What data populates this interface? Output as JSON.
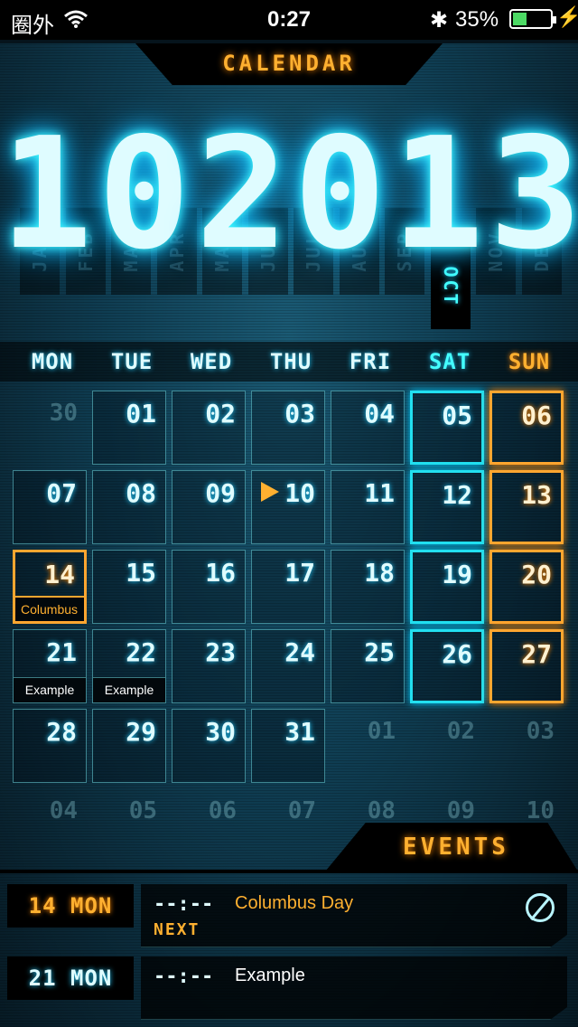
{
  "status_bar": {
    "carrier": "圈外",
    "time": "0:27",
    "battery_percent": "35%",
    "battery_level": 0.35,
    "bluetooth_icon": "bluetooth-icon",
    "wifi_icon": "wifi-icon",
    "charging_icon": "charging-bolt-icon",
    "bluetooth_glyph": "✱",
    "charging_glyph": "⚡"
  },
  "header": {
    "title": "CALENDAR"
  },
  "big_date": {
    "month": "10",
    "year": "2013"
  },
  "months": [
    "JAN",
    "FEB",
    "MAR",
    "APR",
    "MAY",
    "JUN",
    "JUL",
    "AUG",
    "SEP",
    "OCT",
    "NOV",
    "DEC"
  ],
  "active_month": "OCT",
  "weekdays": [
    "MON",
    "TUE",
    "WED",
    "THU",
    "FRI",
    "SAT",
    "SUN"
  ],
  "calendar": {
    "leading": [
      "30"
    ],
    "days": [
      {
        "n": "01"
      },
      {
        "n": "02"
      },
      {
        "n": "03"
      },
      {
        "n": "04"
      },
      {
        "n": "05",
        "type": "sat"
      },
      {
        "n": "06",
        "type": "sun"
      },
      {
        "n": "07"
      },
      {
        "n": "08"
      },
      {
        "n": "09"
      },
      {
        "n": "10",
        "today": true
      },
      {
        "n": "11"
      },
      {
        "n": "12",
        "type": "sat"
      },
      {
        "n": "13",
        "type": "sun"
      },
      {
        "n": "14",
        "holiday": true,
        "event": "Columbus"
      },
      {
        "n": "15"
      },
      {
        "n": "16"
      },
      {
        "n": "17"
      },
      {
        "n": "18"
      },
      {
        "n": "19",
        "type": "sat"
      },
      {
        "n": "20",
        "type": "sun"
      },
      {
        "n": "21",
        "event": "Example"
      },
      {
        "n": "22",
        "event": "Example"
      },
      {
        "n": "23"
      },
      {
        "n": "24"
      },
      {
        "n": "25"
      },
      {
        "n": "26",
        "type": "sat"
      },
      {
        "n": "27",
        "type": "sun"
      },
      {
        "n": "28"
      },
      {
        "n": "29"
      },
      {
        "n": "30"
      },
      {
        "n": "31"
      }
    ],
    "trailing_row5": [
      "01",
      "02",
      "03"
    ],
    "trailing_row6": [
      "04",
      "05",
      "06",
      "07",
      "08",
      "09",
      "10"
    ]
  },
  "events_header": {
    "title": "EVENTS"
  },
  "events": [
    {
      "date": "14 MON",
      "time": "--:--",
      "name": "Columbus Day",
      "tag": "NEXT",
      "holiday": true,
      "action_icon": "block-icon"
    },
    {
      "date": "21 MON",
      "time": "--:--",
      "name": "Example",
      "tag": "",
      "holiday": false
    }
  ],
  "colors": {
    "accent_cyan": "#4ff",
    "accent_orange": "#ffb030",
    "event_orange": "#ffb030",
    "event_white": "#ffffff"
  }
}
